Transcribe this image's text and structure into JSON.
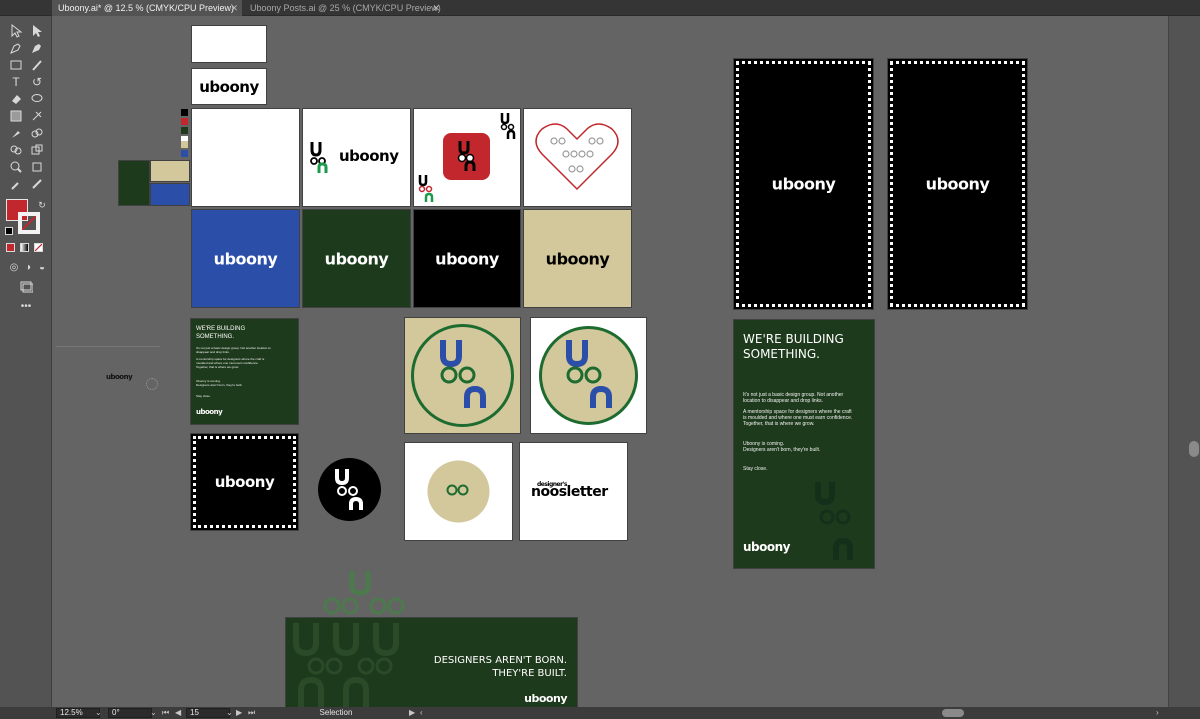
{
  "tabs": [
    {
      "label": "Uboony.ai* @ 12.5 % (CMYK/CPU Preview)",
      "active": true
    },
    {
      "label": "Uboony Posts.ai @ 25 % (CMYK/CPU Preview)",
      "active": false
    }
  ],
  "tools": [
    "selection-tool",
    "direct-selection-tool",
    "pen-tool",
    "curvature-tool",
    "rectangle-tool",
    "paintbrush-tool",
    "type-tool",
    "rotate-tool",
    "eraser-tool",
    "lasso-tool",
    "gradient-tool",
    "eyedropper-tool",
    "mesh-tool",
    "shape-builder-tool",
    "zoom-tool",
    "hand-tool",
    "symbol-sprayer-tool",
    "artboard-tool",
    "more-tools"
  ],
  "colors": {
    "fill": "#c1272d",
    "brand_blue": "#2b4ea9",
    "brand_green": "#1e3a1c",
    "brand_tan": "#d3c79c",
    "brand_red": "#c1272d",
    "canvas": "#646464"
  },
  "artwork": {
    "logo": "uboony",
    "headline": "WE'RE BUILDING\nSOMETHING.",
    "body_1": "It's not just a basic design group. Not another location to disappear and drop links.",
    "body_2": "A mentorship space for designers where the craft is moulded and where one must earn confidence.\nTogether, that is where we grow.",
    "body_3": "Uboony is coming.\nDesigners aren't born, they're built.",
    "body_4": "Stay close.",
    "small_headline": "WE'RE BUILDING\nSOMETHING.",
    "small_body_1": "It's not just a basic design group. Not another location to disappear and drop links.",
    "small_body_2": "A mentorship space for designers where the craft is moulded and where one must earn confidence.\nTogether, that is where we grow.",
    "small_body_3": "Uboony is coming.\nDesigners aren't born, they're built.",
    "small_body_4": "Stay close.",
    "newsletter_top": "designer's",
    "newsletter_main": "noosletter",
    "banner_line1": "DESIGNERS AREN'T BORN.",
    "banner_line2": "THEY'RE BUILT.",
    "mark_u": "U",
    "mark_oo": "oo",
    "mark_n": "n"
  },
  "status": {
    "zoom": "12.5%",
    "rotation": "0°",
    "artboard": "15",
    "tool": "Selection"
  }
}
